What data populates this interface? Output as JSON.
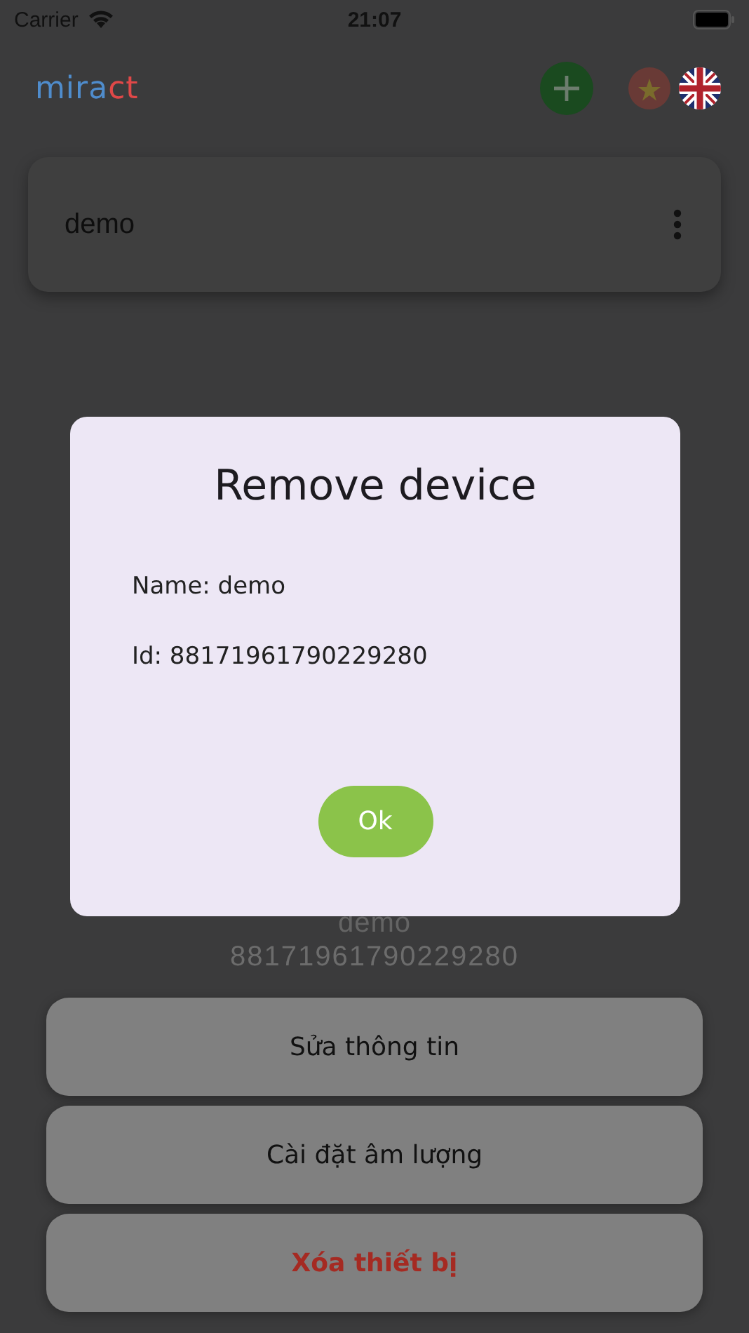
{
  "status_bar": {
    "carrier": "Carrier",
    "time": "21:07"
  },
  "header": {
    "logo_parts": [
      "mira",
      "ct"
    ],
    "languages": [
      {
        "kind": "vietnam",
        "selected": false
      },
      {
        "kind": "uk",
        "selected": true
      }
    ]
  },
  "devices": [
    {
      "name": "demo"
    }
  ],
  "action_sheet": {
    "title": "demo",
    "subtitle": "88171961790229280",
    "actions": [
      {
        "label": "Sửa thông tin",
        "kind": "default"
      },
      {
        "label": "Cài đặt âm lượng",
        "kind": "default"
      },
      {
        "label": "Xóa thiết bị",
        "kind": "destructive"
      }
    ]
  },
  "dialog": {
    "title": "Remove device",
    "lines": [
      "Name: demo",
      "Id: 88171961790229280"
    ],
    "button": "Ok"
  }
}
